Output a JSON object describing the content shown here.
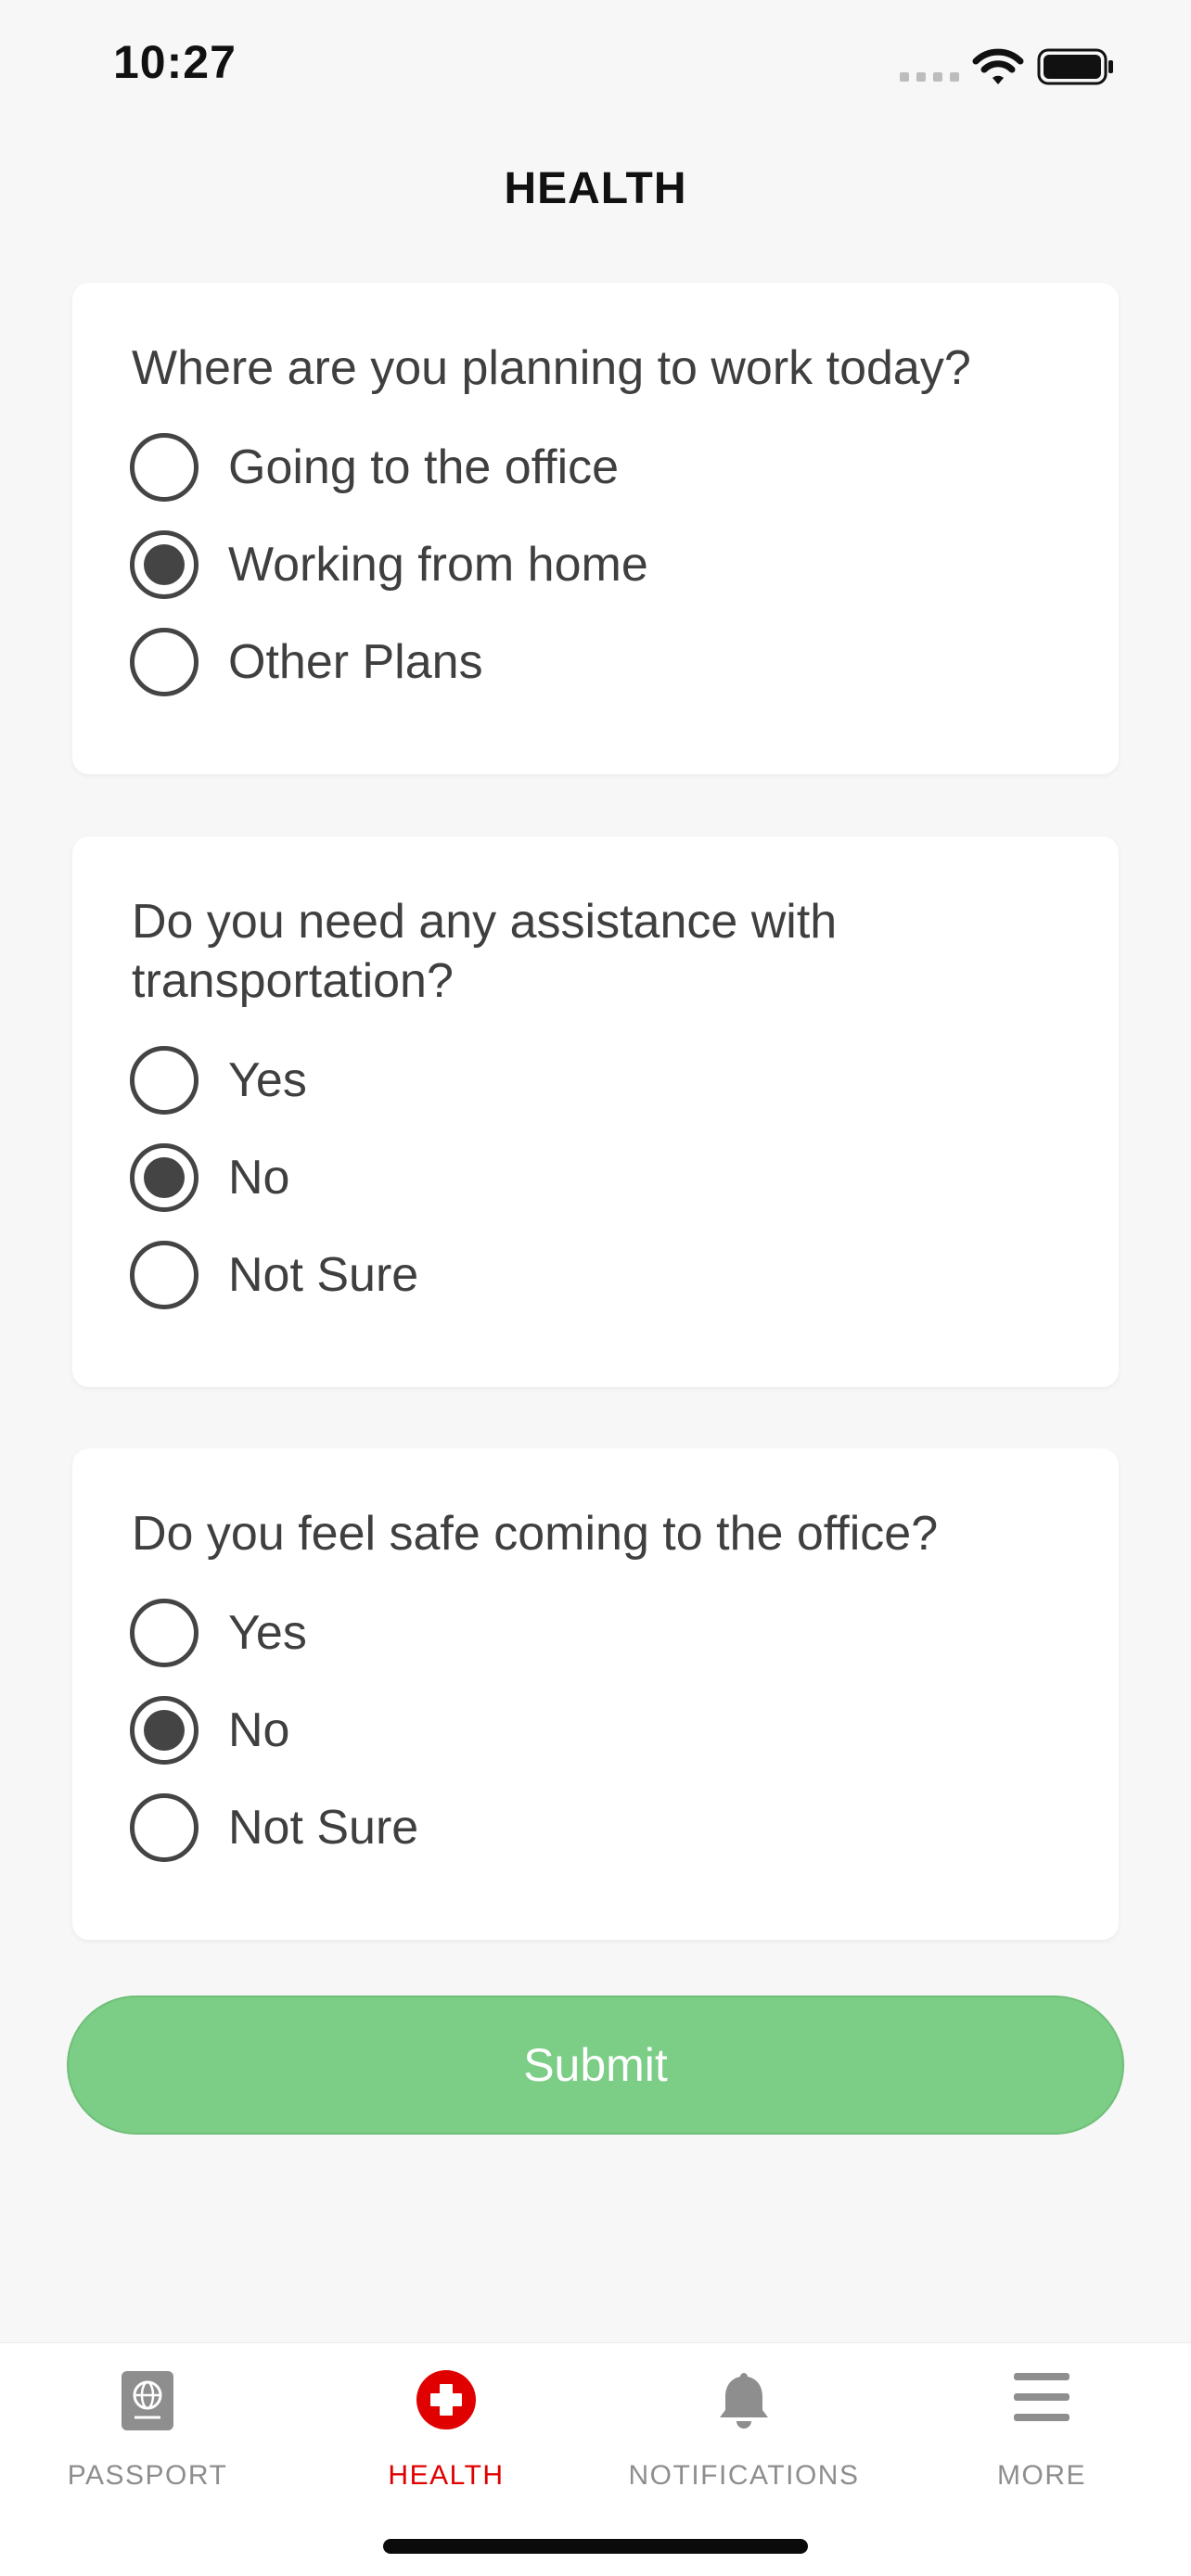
{
  "status_bar": {
    "time": "10:27",
    "icons": [
      "signal-icon",
      "wifi-icon",
      "battery-icon"
    ]
  },
  "header": {
    "title": "HEALTH"
  },
  "questions": [
    {
      "text": "Where are you planning to work today?",
      "options": [
        {
          "label": "Going to the office",
          "selected": false
        },
        {
          "label": "Working from home",
          "selected": true
        },
        {
          "label": "Other Plans",
          "selected": false
        }
      ]
    },
    {
      "text": "Do you need any assistance with transportation?",
      "options": [
        {
          "label": "Yes",
          "selected": false
        },
        {
          "label": "No",
          "selected": true
        },
        {
          "label": "Not Sure",
          "selected": false
        }
      ]
    },
    {
      "text": "Do you feel safe coming to the office?",
      "options": [
        {
          "label": "Yes",
          "selected": false
        },
        {
          "label": "No",
          "selected": true
        },
        {
          "label": "Not Sure",
          "selected": false
        }
      ]
    }
  ],
  "submit": {
    "label": "Submit",
    "color": "#7ccd85"
  },
  "tab_bar": {
    "active": "HEALTH",
    "active_color": "#e00000",
    "items": [
      {
        "label": "PASSPORT",
        "icon": "passport-icon"
      },
      {
        "label": "HEALTH",
        "icon": "health-cross-icon"
      },
      {
        "label": "NOTIFICATIONS",
        "icon": "bell-icon"
      },
      {
        "label": "MORE",
        "icon": "hamburger-menu-icon"
      }
    ]
  }
}
